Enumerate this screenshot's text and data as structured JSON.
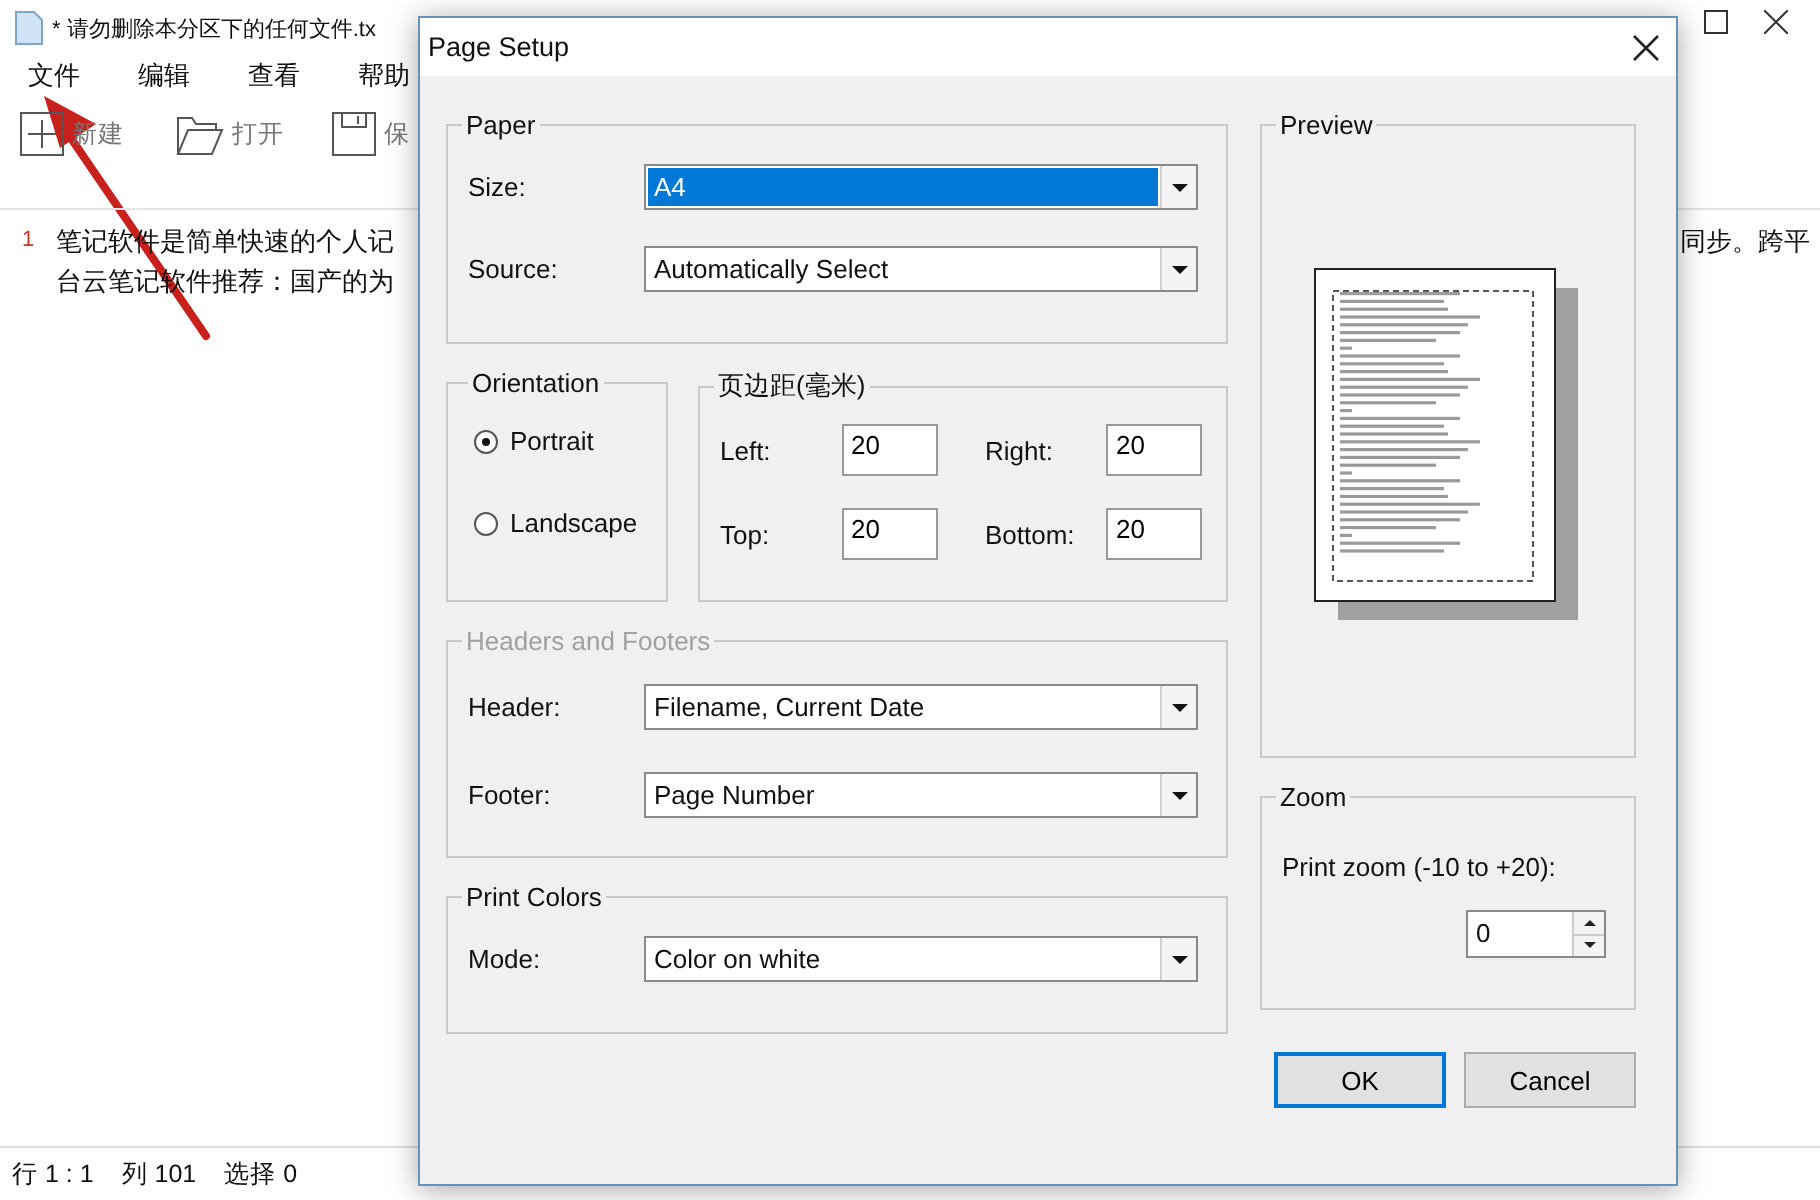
{
  "app": {
    "title": "* 请勿删除本分区下的任何文件.tx",
    "menu": [
      "文件",
      "编辑",
      "查看",
      "帮助"
    ],
    "toolbar": [
      {
        "label": "新建"
      },
      {
        "label": "打开"
      },
      {
        "label": "保"
      }
    ],
    "editor": {
      "line_number": "1",
      "lines": [
        {
          "left": "笔记软件是简单快速的个人记",
          "right": "同步。跨平"
        },
        {
          "left": "台云笔记软件推荐：国产的为"
        }
      ]
    },
    "status_bar": [
      "行 1 : 1",
      "列 101",
      "选择 0"
    ]
  },
  "dialog": {
    "title": "Page Setup",
    "paper": {
      "legend": "Paper",
      "fields": [
        {
          "label": "Size:",
          "value": "A4",
          "highlighted": true
        },
        {
          "label": "Source:",
          "value": "Automatically Select",
          "highlighted": false
        }
      ]
    },
    "orientation": {
      "legend": "Orientation",
      "options": [
        {
          "label": "Portrait",
          "selected": true
        },
        {
          "label": "Landscape",
          "selected": false
        }
      ]
    },
    "margins": {
      "legend": "页边距(毫米)",
      "fields": [
        {
          "label": "Left:",
          "value": "20"
        },
        {
          "label": "Right:",
          "value": "20"
        },
        {
          "label": "Top:",
          "value": "20"
        },
        {
          "label": "Bottom:",
          "value": "20"
        }
      ]
    },
    "headers": {
      "legend": "Headers and Footers",
      "disabled": true,
      "fields": [
        {
          "label": "Header:",
          "value": "Filename, Current Date",
          "highlighted": false
        },
        {
          "label": "Footer:",
          "value": "Page Number",
          "highlighted": false
        }
      ]
    },
    "colors": {
      "legend": "Print Colors",
      "fields": [
        {
          "label": "Mode:",
          "value": "Color on white",
          "highlighted": false
        }
      ]
    },
    "preview": {
      "legend": "Preview"
    },
    "zoom": {
      "legend": "Zoom",
      "label": "Print zoom (-10 to +20):",
      "value": "0"
    },
    "buttons": [
      "OK",
      "Cancel"
    ]
  }
}
